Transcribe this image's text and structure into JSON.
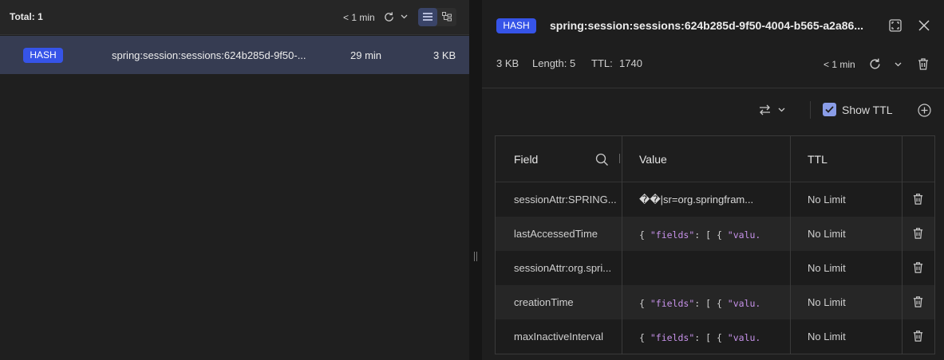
{
  "left": {
    "total_label": "Total: 1",
    "refresh_time": "< 1 min",
    "keys": [
      {
        "type": "HASH",
        "name": "spring:session:sessions:624b285d-9f50-...",
        "ttl": "29 min",
        "size": "3 KB"
      }
    ]
  },
  "details": {
    "type": "HASH",
    "key_name": "spring:session:sessions:624b285d-9f50-4004-b565-a2a86...",
    "size": "3 KB",
    "length": "Length: 5",
    "ttl_label": "TTL:",
    "ttl_value": "1740",
    "refresh_time": "< 1 min",
    "show_ttl_label": "Show TTL",
    "show_ttl_checked": true,
    "table": {
      "headers": {
        "field": "Field",
        "value": "Value",
        "ttl": "TTL"
      },
      "rows": [
        {
          "field": "sessionAttr:SPRING...",
          "value_text": "��|sr=org.springfram...",
          "value_json": false,
          "ttl": "No Limit"
        },
        {
          "field": "lastAccessedTime",
          "value_prefix": "{ ",
          "value_key": "\"fields\"",
          "value_mid": ": [ { ",
          "value_tail": "\"valu...",
          "value_json": true,
          "ttl": "No Limit"
        },
        {
          "field": "sessionAttr:org.spri...",
          "value_text": "",
          "value_json": false,
          "ttl": "No Limit"
        },
        {
          "field": "creationTime",
          "value_prefix": "{ ",
          "value_key": "\"fields\"",
          "value_mid": ": [ { ",
          "value_tail": "\"valu...",
          "value_json": true,
          "ttl": "No Limit"
        },
        {
          "field": "maxInactiveInterval",
          "value_prefix": "{ ",
          "value_key": "\"fields\"",
          "value_mid": ": [ { ",
          "value_tail": "\"valu...",
          "value_json": true,
          "ttl": "No Limit"
        }
      ]
    }
  },
  "colors": {
    "accent": "#3654e8",
    "selected_row": "#363c52",
    "json_string": "#c792ea"
  }
}
